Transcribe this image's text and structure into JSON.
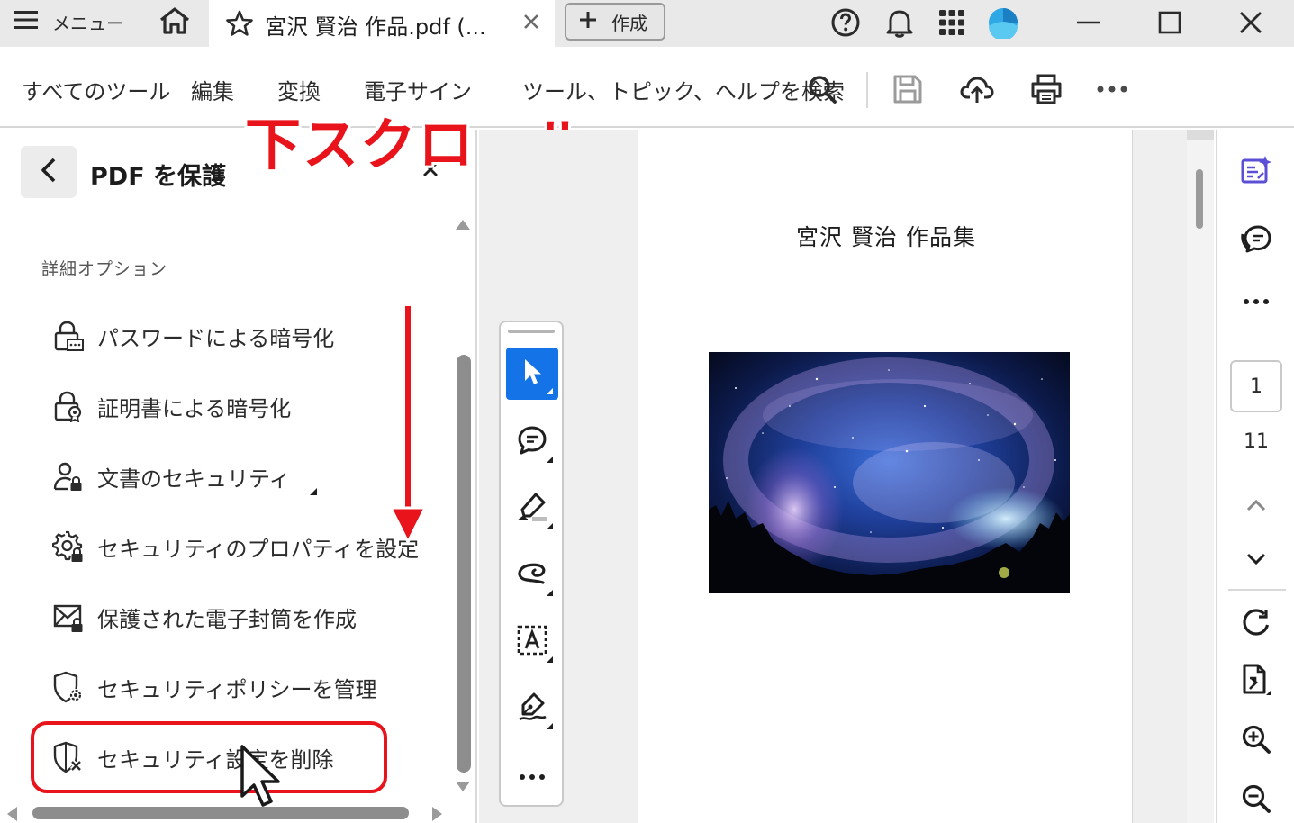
{
  "titlebar": {
    "menu_label": "メニュー",
    "tab_title": "宮沢 賢治 作品.pdf (...",
    "create_label": "作成"
  },
  "toolbar": {
    "links": [
      "すべてのツール",
      "編集",
      "変換",
      "電子サイン"
    ],
    "search_label": "ツール、トピック、ヘルプを検索"
  },
  "panel": {
    "title": "PDF を保護",
    "section_label": "詳細オプション",
    "options": [
      "パスワードによる暗号化",
      "証明書による暗号化",
      "文書のセキュリティ",
      "セキュリティのプロパティを設定",
      "保護された電子封筒を作成",
      "セキュリティポリシーを管理",
      "セキュリティ設定を削除"
    ]
  },
  "annotation": {
    "scroll_text": "下スクロール",
    "color": "#e8131b"
  },
  "document": {
    "page_title": "宮沢  賢治  作品集"
  },
  "rail": {
    "current_page": "1",
    "total_pages": "11"
  },
  "colors": {
    "accent": "#1473e6",
    "highlight": "#e8131b",
    "ai_purple": "#5b4fd6"
  }
}
